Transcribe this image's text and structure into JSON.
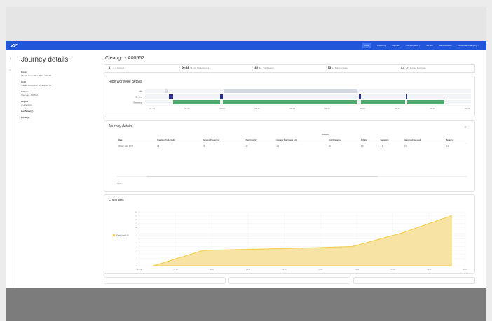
{
  "nav": {
    "items": [
      {
        "label": "Live",
        "active": true
      },
      {
        "label": "Reporting",
        "active": false
      },
      {
        "label": "Logbook",
        "active": false
      },
      {
        "label": "Configuration ⌄",
        "active": false
      },
      {
        "label": "Service",
        "active": false
      },
      {
        "label": "Administration",
        "active": false
      },
      {
        "label": "Accelerated Hanging ⌄",
        "active": false
      }
    ]
  },
  "left": {
    "title": "Journey details",
    "fields": [
      {
        "label": "From",
        "value": "Thu 28 December 2022 at 07:57"
      },
      {
        "label": "Until",
        "value": "Thu 28 December 2022 at 09:36"
      },
      {
        "label": "Vehicles",
        "value": "Cleango - A00552"
      },
      {
        "label": "Depots",
        "value": "Amsterdam"
      },
      {
        "label": "Geofence(s)",
        "value": ""
      },
      {
        "label": "Driver(s)",
        "value": ""
      }
    ]
  },
  "main": {
    "title": "Cleango - A00552",
    "stats": [
      {
        "value": "1",
        "unit": "",
        "label": "nr of Journeys"
      },
      {
        "value": "00:54",
        "unit": "hh:mm",
        "label": "Productive time"
      },
      {
        "value": "45",
        "unit": "km",
        "label": "Total Distance"
      },
      {
        "value": "13",
        "unit": "L",
        "label": "Total Fuel usage"
      },
      {
        "value": "4.4",
        "unit": "L/h",
        "label": "Average Fuel Usage"
      }
    ]
  },
  "ride": {
    "title": "Ride worktype details",
    "rows": [
      "Idle",
      "Driving",
      "Sweeping"
    ],
    "ticks": [
      "07:30",
      "07:45",
      "08:00",
      "08:15",
      "08:30",
      "08:45",
      "09:00",
      "09:15",
      "09:30",
      "09:45"
    ]
  },
  "journey": {
    "title": "Journey details",
    "tools": "⚙ ⋮",
    "distance_group": "Distance",
    "headers": [
      "Date",
      "Duration Productivity",
      "Duration Productive",
      "Fuel Used (L)",
      "Average Fuel Usage (L/h)",
      "Total Distance",
      "Driving",
      "Sweeping",
      "Handmachine used",
      "Spraying"
    ],
    "rows": [
      [
        "28 Dec 2022 07:57",
        "99",
        "54",
        "13",
        "4.4",
        "45",
        "6.8",
        "4.3",
        "0.0",
        "0.0"
      ]
    ],
    "rows_label": "Rows: 1"
  },
  "fuel": {
    "title": "Fuel Data",
    "legend": "Fuel Used (L)",
    "color": "#f2cc45",
    "y_ticks": [
      "0",
      "1",
      "2",
      "3",
      "4",
      "5",
      "6",
      "7",
      "8",
      "9",
      "10",
      "11",
      "12",
      "13",
      "14"
    ],
    "x_ticks": [
      "07:45",
      "08:00",
      "08:15",
      "08:30",
      "08:45",
      "09:00",
      "09:15",
      "09:30",
      "09:45",
      "10:00"
    ]
  },
  "chart_data": {
    "type": "area",
    "x": [
      "07:57",
      "08:15",
      "08:30",
      "08:45",
      "09:00",
      "09:15",
      "09:36"
    ],
    "series": [
      {
        "name": "Fuel Used (L)",
        "values": [
          0,
          4,
          4.3,
          4.6,
          5,
          8.5,
          13
        ]
      }
    ],
    "ylim": [
      0,
      14
    ],
    "grid": true,
    "legend": "left"
  }
}
